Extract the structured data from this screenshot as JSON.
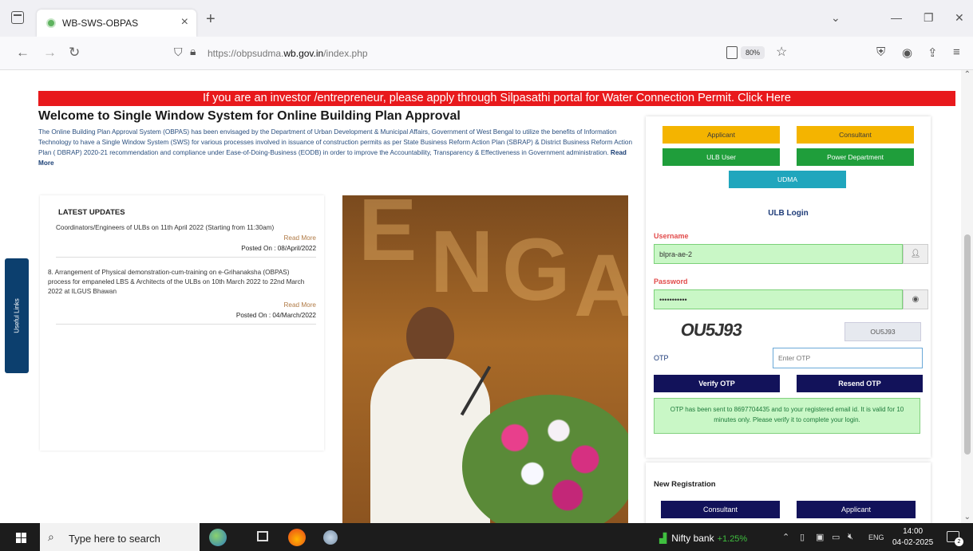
{
  "browser": {
    "tab_title": "WB-SWS-OBPAS",
    "tab_close": "×",
    "new_tab": "+",
    "url_prefix": "https://obpsudma.",
    "url_domain": "wb.gov.in",
    "url_path": "/index.php",
    "zoom": "80%",
    "win_dropdown": "⌄",
    "win_minimize": "—",
    "win_restore": "❐",
    "win_close": "✕"
  },
  "banner": {
    "text": "If you are an investor /entrepreneur, please apply through Silpasathi portal for Water Connection Permit. Click Here"
  },
  "welcome": {
    "title": "Welcome to Single Window System for Online Building Plan Approval",
    "body": "The Online Building Plan Approval System (OBPAS) has been envisaged by the Department of Urban Development & Municipal Affairs, Government of West Bengal to utilize the benefits of Information Technology to have a Single Window System (SWS) for various processes involved in issuance of construction permits as per State Business Reform Action Plan (SBRAP) & District Business Reform Action Plan ( DBRAP) 2020-21 recommendation and compliance under Ease-of-Doing-Business (EODB) in order to improve the Accountability, Transparency & Effectiveness in Government administration.",
    "read_more": "Read More"
  },
  "useful_links": "Useful Links",
  "updates": {
    "heading": "LATEST UPDATES",
    "items": [
      {
        "text": "Coordinators/Engineers of ULBs on 11th April 2022 (Starting from 11:30am)",
        "read_more": "Read More",
        "posted": "Posted On : 08/April/2022"
      },
      {
        "text": "8. Arrangement of Physical demonstration-cum-training on e-Grihanaksha (OBPAS) process for empaneled LBS & Architects of the ULBs on 10th March 2022 to 22nd March 2022 at ILGUS Bhawan",
        "read_more": "Read More",
        "posted": "Posted On : 04/March/2022"
      }
    ]
  },
  "login": {
    "roles": {
      "applicant": "Applicant",
      "consultant": "Consultant",
      "ulb_user": "ULB User",
      "power_department": "Power Department",
      "udma": "UDMA"
    },
    "title": "ULB Login",
    "username_label": "Username",
    "username_value": "blpra-ae-2",
    "password_label": "Password",
    "password_value": "•••••••••••",
    "captcha_image_text": "OU5J93",
    "captcha_value": "OU5J93",
    "otp_label": "OTP",
    "otp_placeholder": "Enter OTP",
    "verify_otp": "Verify OTP",
    "resend_otp": "Resend OTP",
    "otp_message": "OTP has been sent to 8697704435 and to your registered email id. It is valid for 10 minutes only. Please verify it to complete your login."
  },
  "registration": {
    "title": "New Registration",
    "consultant": "Consultant",
    "applicant": "Applicant"
  },
  "taskbar": {
    "search_text": "Type here to search",
    "nifty_label": "Nifty bank",
    "nifty_change": "+1.25%",
    "lang": "ENG",
    "time": "14:00",
    "date": "04-02-2025",
    "notif_count": "2"
  },
  "colors": {
    "banner_red": "#e8191c",
    "applicant_yellow": "#f4b400",
    "ulb_green": "#1f9e3b",
    "udma_teal": "#20a6bd",
    "navy_button": "#12125a"
  }
}
